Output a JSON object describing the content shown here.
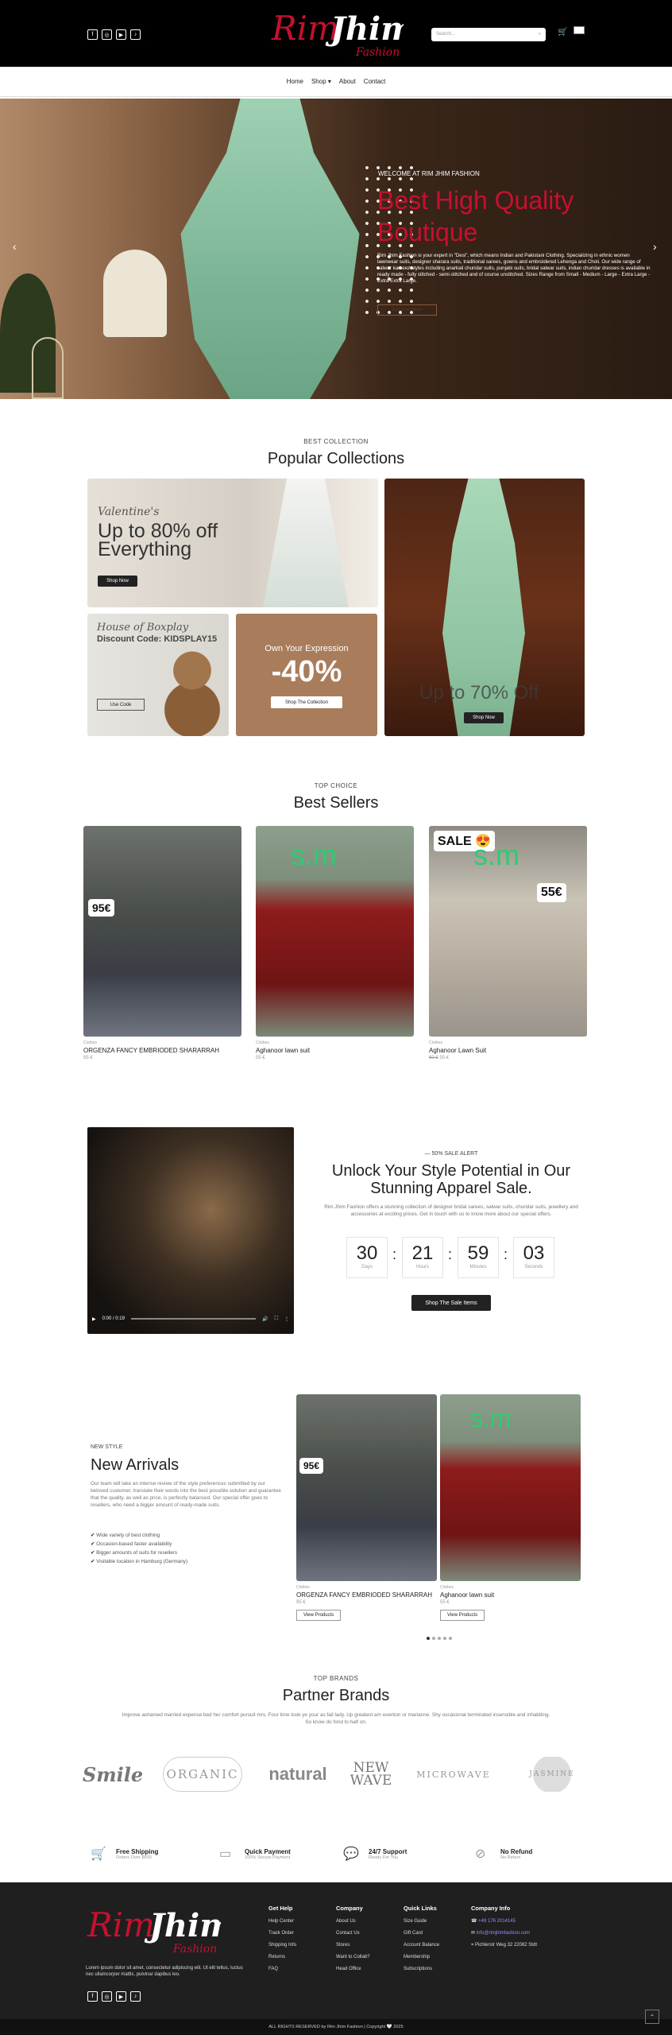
{
  "header": {
    "logo_main": "Rim Jhim",
    "logo_sub": "Fashion",
    "social": [
      "f",
      "◎",
      "▶",
      "♪"
    ],
    "search_placeholder": "Search...",
    "search_icon": "search-icon",
    "cart_icon": "cart-icon"
  },
  "nav": {
    "items": [
      "Home",
      "Shop",
      "About",
      "Contact"
    ],
    "shop_caret": "▾"
  },
  "hero": {
    "subtitle": "WELCOME AT RIM JHIM FASHION",
    "title": "Best High Quality Boutique",
    "text": "Rim Jhim Fashion is your expert in \"Desi\", which means Indian and Pakistani Clothing. Specializing in ethnic women lawnwear suits, designer sharara suits, traditional sarees, gowns and embroidered Lehenga and Choli. Our wide range of salwar kameez styles including anarkali churidar suits, punjabi suits, bridal salwar suits, indian churidar dresses is available in ready made - fully stitched - semi-stitched and of course unstitched. Sizes Range from Small - Medium - Large - Extra Large - Extra Extra Large.",
    "button": "Discover More",
    "prev": "‹",
    "next": "›"
  },
  "collections": {
    "subtitle": "BEST COLLECTION",
    "title": "Popular Collections",
    "promo1": {
      "script": "Valentine's",
      "line1": "Up to  80% off",
      "line2": "Everything",
      "button": "Shop Now"
    },
    "promo2": {
      "text": "Up to 70% Off",
      "button": "Shop Now"
    },
    "promo3": {
      "script": "House of Boxplay",
      "code": "Discount Code: KIDSPLAY15",
      "button": "Use Code"
    },
    "promo4": {
      "line1": "Own Your Expression",
      "discount": "-40%",
      "button": "Shop The Collection"
    }
  },
  "bestsellers": {
    "subtitle": "TOP CHOICE",
    "title": "Best Sellers",
    "products": [
      {
        "category": "Clothes",
        "name": "ORGENZA FANCY EMBRIODED SHARARRAH",
        "price": "95 €",
        "badge": "95€",
        "watermark": ""
      },
      {
        "category": "Clothes",
        "name": "Aghanoor lawn suit",
        "price": "55 €",
        "badge": "",
        "watermark": "s.m"
      },
      {
        "category": "Clothes",
        "name": "Aghanoor Lawn Suit",
        "old_price": "60 €",
        "price": "55 €",
        "badge": "55€",
        "sale": "SALE 😍",
        "watermark": "s.m"
      }
    ]
  },
  "sale": {
    "tag": "— 50% SALE ALERT",
    "title": "Unlock Your Style Potential in Our Stunning Apparel Sale.",
    "text": "Rim Jhim Fashion offers a stunning collection of designer bridal sarees, salwar suits, churidar suits, jewellery and accessories at exciting prices. Get in touch with us to know more about our special offers.",
    "countdown": [
      {
        "value": "30",
        "label": "Days"
      },
      {
        "value": "21",
        "label": "Hours"
      },
      {
        "value": "59",
        "label": "Minutes"
      },
      {
        "value": "03",
        "label": "Seconds"
      }
    ],
    "button": "Shop The Sale Items",
    "video_time": "0:00 / 0:19"
  },
  "new_arrivals": {
    "subtitle": "NEW STYLE",
    "title": "New Arrivals",
    "text": "Our team will take an intense review of the style preferences submitted by our beloved customer, translate their words into the best possible solution and guarantee that the quality, as well as price, is perfectly balanced. Our special offer goes to resellers, who need a bigger amount of ready-made suits.",
    "features": [
      "Wide variety of best clothing",
      "Occasion-based faster availability",
      "Bigger amounts of suits for resellers",
      "Visitable location in Hamburg (Germany)"
    ],
    "products": [
      {
        "category": "Clothes",
        "name": "ORGENZA FANCY EMBRIODED SHARARRAH",
        "price": "95 €",
        "badge": "95€",
        "button": "View Products"
      },
      {
        "category": "Clothes",
        "name": "Aghanoor lawn suit",
        "price": "55 €",
        "watermark": "s.m",
        "button": "View Products"
      }
    ]
  },
  "brands": {
    "subtitle": "TOP BRANDS",
    "title": "Partner Brands",
    "text": "Improve ashamed married expense bed her comfort pursuit mrs. Four time took ye your as fail lady. Up greatest am exertion or marianne. Shy occasional terminated insensible and inhabiting. So know do fond to half on.",
    "logos": [
      "Smile",
      "ORGANIC",
      "natural",
      "NEW WAVE",
      "MICROWAVE",
      "JASMINE"
    ]
  },
  "features": [
    {
      "title": "Free Shipping",
      "sub": "Orders Over $600"
    },
    {
      "title": "Quick Payment",
      "sub": "100% Secure Payment"
    },
    {
      "title": "24/7 Support",
      "sub": "Ready For You"
    },
    {
      "title": "No Refund",
      "sub": "No Return"
    }
  ],
  "footer": {
    "text": "Lorem ipsum dolor sit amet, consectetur adipiscing elit. Ut elit tellus, luctus nec ullamcorper mattis, pulvinar dapibus leo.",
    "get_help": {
      "title": "Get Help",
      "items": [
        "Help Center",
        "Track Order",
        "Shipping Info",
        "Returns",
        "FAQ"
      ]
    },
    "company": {
      "title": "Company",
      "items": [
        "About Us",
        "Contact Us",
        "Stores",
        "Want to Collab?",
        "Head Office"
      ]
    },
    "quick_links": {
      "title": "Quick Links",
      "items": [
        "Size Guide",
        "Gift Card",
        "Account Balance",
        "Membership",
        "Subscriptions"
      ]
    },
    "company_info": {
      "title": "Company Info",
      "phone": "+49 176 2014145",
      "email": "info@rimjhimfashion.com",
      "address": "Pichlerstr Weg 32 22082 Stdt"
    },
    "copyright": "ALL RIGHTS RESERVED by Rim Jhim Fashion | Copyright 🤍 2025",
    "to_top": "⌃"
  }
}
